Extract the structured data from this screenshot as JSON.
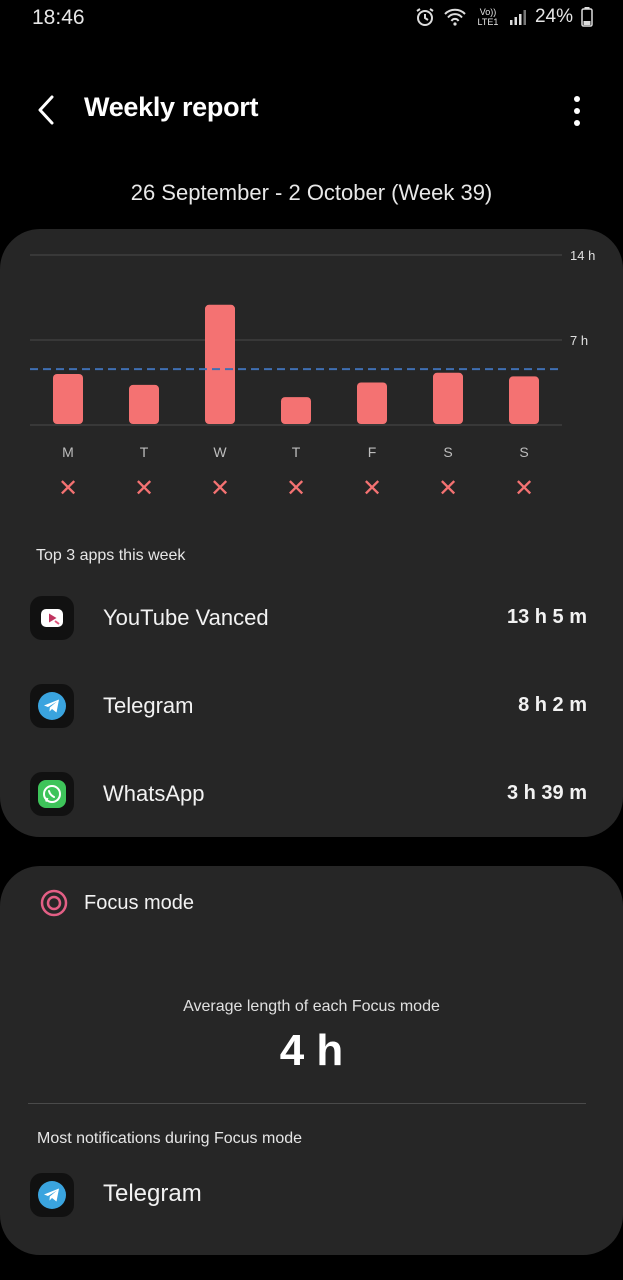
{
  "status_bar": {
    "time": "18:46",
    "battery": "24%",
    "network": "Vo)) LTE1",
    "icons": [
      "alarm-icon",
      "wifi-icon",
      "signal-icon",
      "battery-icon"
    ]
  },
  "header": {
    "title": "Weekly report",
    "back_icon": "chevron-left-icon",
    "more_icon": "more-vertical-icon"
  },
  "week_range": "26 September - 2 October (Week 39)",
  "chart_data": {
    "type": "bar",
    "categories": [
      "M",
      "T",
      "W",
      "T",
      "F",
      "S",
      "S"
    ],
    "values": [
      4.2,
      3.3,
      9.9,
      2.3,
      3.5,
      4.3,
      4.0
    ],
    "unit": "h",
    "y_ticks": [
      "14 h",
      "7 h"
    ],
    "ylim": [
      0,
      14
    ],
    "average": 4.6,
    "grid": true,
    "colors": {
      "bar": "#f47272",
      "average_line": "#3f6fb3",
      "grid": "#4a4a4a",
      "goal_mark": "#f47272"
    },
    "goal_marks": [
      "✕",
      "✕",
      "✕",
      "✕",
      "✕",
      "✕",
      "✕"
    ]
  },
  "top_apps": {
    "label": "Top 3 apps this week",
    "items": [
      {
        "name": "YouTube Vanced",
        "time": "13 h 5 m",
        "icon": "youtube-vanced-icon"
      },
      {
        "name": "Telegram",
        "time": "8 h 2 m",
        "icon": "telegram-icon"
      },
      {
        "name": "WhatsApp",
        "time": "3 h 39 m",
        "icon": "whatsapp-icon"
      }
    ]
  },
  "focus_mode": {
    "title": "Focus mode",
    "icon": "focus-target-icon",
    "avg_label": "Average length of each Focus mode",
    "avg_value": "4 h",
    "most_notifications_label": "Most notifications during Focus mode",
    "top_app": {
      "name": "Telegram",
      "icon": "telegram-icon"
    }
  },
  "colors": {
    "background": "#000000",
    "card": "#262626",
    "accent": "#f47272"
  }
}
